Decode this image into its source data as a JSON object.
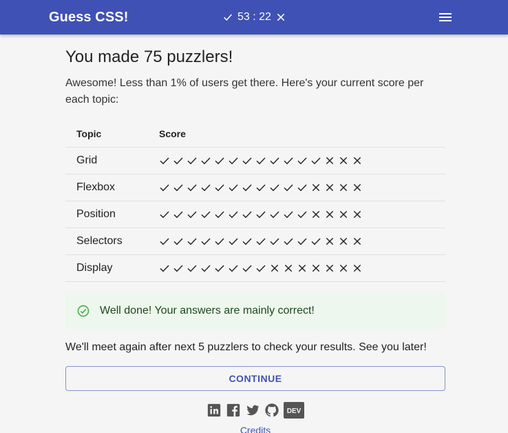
{
  "app": {
    "title": "Guess CSS!",
    "stats": "53 : 22"
  },
  "main": {
    "heading": "You made 75 puzzlers!",
    "intro": "Awesome! Less than 1% of users get there. Here's your current score per each topic:",
    "table": {
      "headers": [
        "Topic",
        "Score"
      ],
      "rows": [
        {
          "topic": "Grid",
          "correct": 12,
          "total": 15
        },
        {
          "topic": "Flexbox",
          "correct": 11,
          "total": 15
        },
        {
          "topic": "Position",
          "correct": 11,
          "total": 15
        },
        {
          "topic": "Selectors",
          "correct": 12,
          "total": 15
        },
        {
          "topic": "Display",
          "correct": 8,
          "total": 15
        }
      ]
    },
    "alert": "Well done! Your answers are mainly correct!",
    "outro": "We'll meet again after next 5 puzzlers to check your results. See you later!",
    "continue_label": "CONTINUE"
  },
  "footer": {
    "socials": [
      "linkedin-icon",
      "facebook-icon",
      "twitter-icon",
      "github-icon",
      "dev-icon"
    ],
    "dev_label": "DEV",
    "credits": "Credits"
  },
  "colors": {
    "primary": "#3f51b5",
    "success_bg": "#edf7ed",
    "success_icon": "#4caf50",
    "success_text": "#1e4620"
  }
}
